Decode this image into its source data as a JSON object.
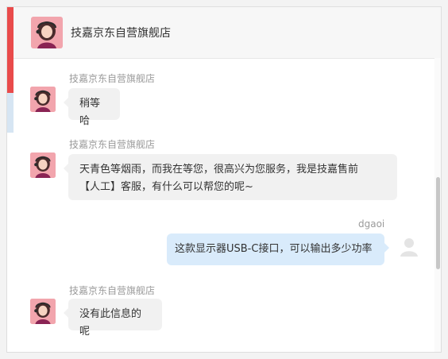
{
  "header": {
    "title": "技嘉京东自营旗舰店"
  },
  "messages": [
    {
      "sender": "技嘉京东自营旗舰店",
      "text": "稍等哈"
    },
    {
      "sender": "技嘉京东自营旗舰店",
      "line1": "天青色等烟雨，而我在等您，很高兴为您服务，我是技嘉售前",
      "line2": "【人工】客服，有什么可以帮您的呢~"
    },
    {
      "sender": "dgaoi",
      "text": "这款显示器USB-C接口，可以输出多少功率"
    },
    {
      "sender": "技嘉京东自营旗舰店",
      "text": "没有此信息的呢"
    }
  ],
  "icons": {
    "shop_avatar": "agent-avatar-icon",
    "user_avatar": "user-avatar-icon"
  },
  "colors": {
    "accent": "#e94b4b",
    "user_bubble": "#d9ebfb",
    "agent_bubble": "#f1f1f1"
  }
}
